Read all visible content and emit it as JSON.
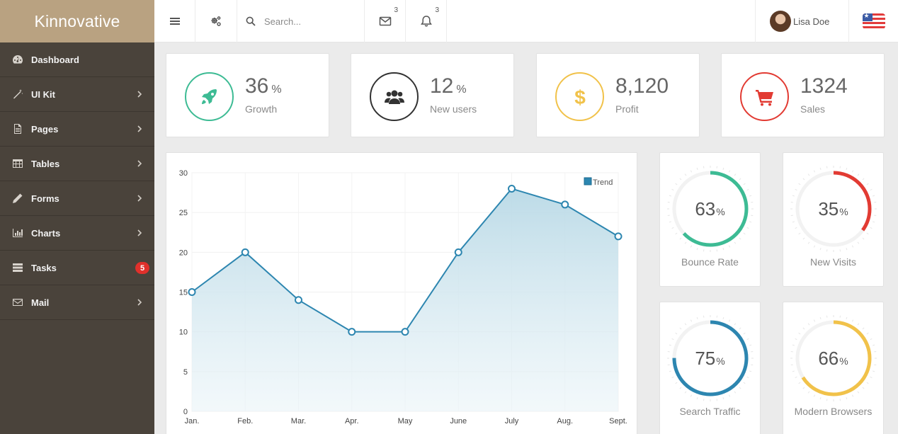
{
  "brand": "Kinnovative",
  "sidebar": {
    "items": [
      {
        "label": "Dashboard"
      },
      {
        "label": "UI Kit"
      },
      {
        "label": "Pages"
      },
      {
        "label": "Tables"
      },
      {
        "label": "Forms"
      },
      {
        "label": "Charts"
      },
      {
        "label": "Tasks",
        "badge": "5"
      },
      {
        "label": "Mail"
      }
    ]
  },
  "topbar": {
    "search_placeholder": "Search...",
    "mail_count": "3",
    "notif_count": "3",
    "user_name": "Lisa Doe"
  },
  "stats": [
    {
      "value": "36",
      "unit": "%",
      "label": "Growth",
      "color": "#3dbb94",
      "icon": "rocket-icon"
    },
    {
      "value": "12",
      "unit": "%",
      "label": "New users",
      "color": "#333333",
      "icon": "users-icon"
    },
    {
      "value": "8,120",
      "unit": "",
      "label": "Profit",
      "color": "#f1c24a",
      "icon": "dollar-icon"
    },
    {
      "value": "1324",
      "unit": "",
      "label": "Sales",
      "color": "#e23b33",
      "icon": "cart-icon"
    }
  ],
  "gauges": [
    {
      "value": "63",
      "unit": "%",
      "label": "Bounce Rate",
      "percent": 63,
      "color": "#3dbb94"
    },
    {
      "value": "35",
      "unit": "%",
      "label": "New Visits",
      "percent": 35,
      "color": "#e23b33"
    },
    {
      "value": "75",
      "unit": "%",
      "label": "Search Traffic",
      "percent": 75,
      "color": "#2d86b0"
    },
    {
      "value": "66",
      "unit": "%",
      "label": "Modern Browsers",
      "percent": 66,
      "color": "#f1c24a"
    }
  ],
  "chart_data": {
    "type": "area",
    "categories": [
      "Jan.",
      "Feb.",
      "Mar.",
      "Apr.",
      "May",
      "June",
      "July",
      "Aug.",
      "Sept."
    ],
    "series": [
      {
        "name": "Trend",
        "values": [
          15,
          20,
          14,
          10,
          10,
          20,
          28,
          26,
          22
        ]
      }
    ],
    "yticks": [
      "0",
      "5",
      "10",
      "15",
      "20",
      "25",
      "30"
    ],
    "ylim": [
      0,
      30
    ],
    "legend": "top-right",
    "grid": true,
    "color": "#2d86b0"
  }
}
